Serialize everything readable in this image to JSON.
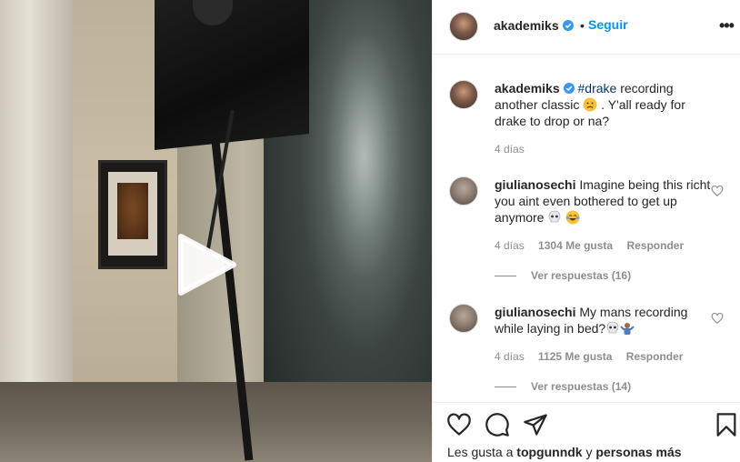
{
  "post": {
    "username": "akademiks",
    "separator": "•",
    "follow_label": "Seguir",
    "more_label": "•••"
  },
  "caption": {
    "username": "akademiks",
    "hashtag": "#drake",
    "text_a": " recording another classic ",
    "text_b": " . Y'all ready for drake to drop or na?",
    "time": "4 días"
  },
  "comments": [
    {
      "username": "giulianosechi",
      "text": " Imagine being this richt you aint even bothered to get up anymore ",
      "time": "4 días",
      "likes": "1304 Me gusta",
      "reply_label": "Responder",
      "view_replies": "Ver respuestas (16)"
    },
    {
      "username": "giulianosechi",
      "text": " My mans recording while laying in bed?",
      "time": "4 días",
      "likes": "1125 Me gusta",
      "reply_label": "Responder",
      "view_replies": "Ver respuestas (14)"
    }
  ],
  "likes_line": {
    "prefix": "Les gusta a ",
    "user": "topgunndk",
    "middle": " y ",
    "others": "personas más"
  },
  "icons": {
    "play": "play-icon",
    "verified": "verified-badge-icon",
    "more": "more-options-icon",
    "heart": "heart-icon",
    "comment": "comment-icon",
    "share": "share-icon",
    "save": "bookmark-icon"
  },
  "colors": {
    "accent": "#0095f6",
    "verified": "#3897f0",
    "text": "#262626",
    "muted": "#8e8e8e",
    "hashtag": "#00376b",
    "border": "#efefef"
  }
}
